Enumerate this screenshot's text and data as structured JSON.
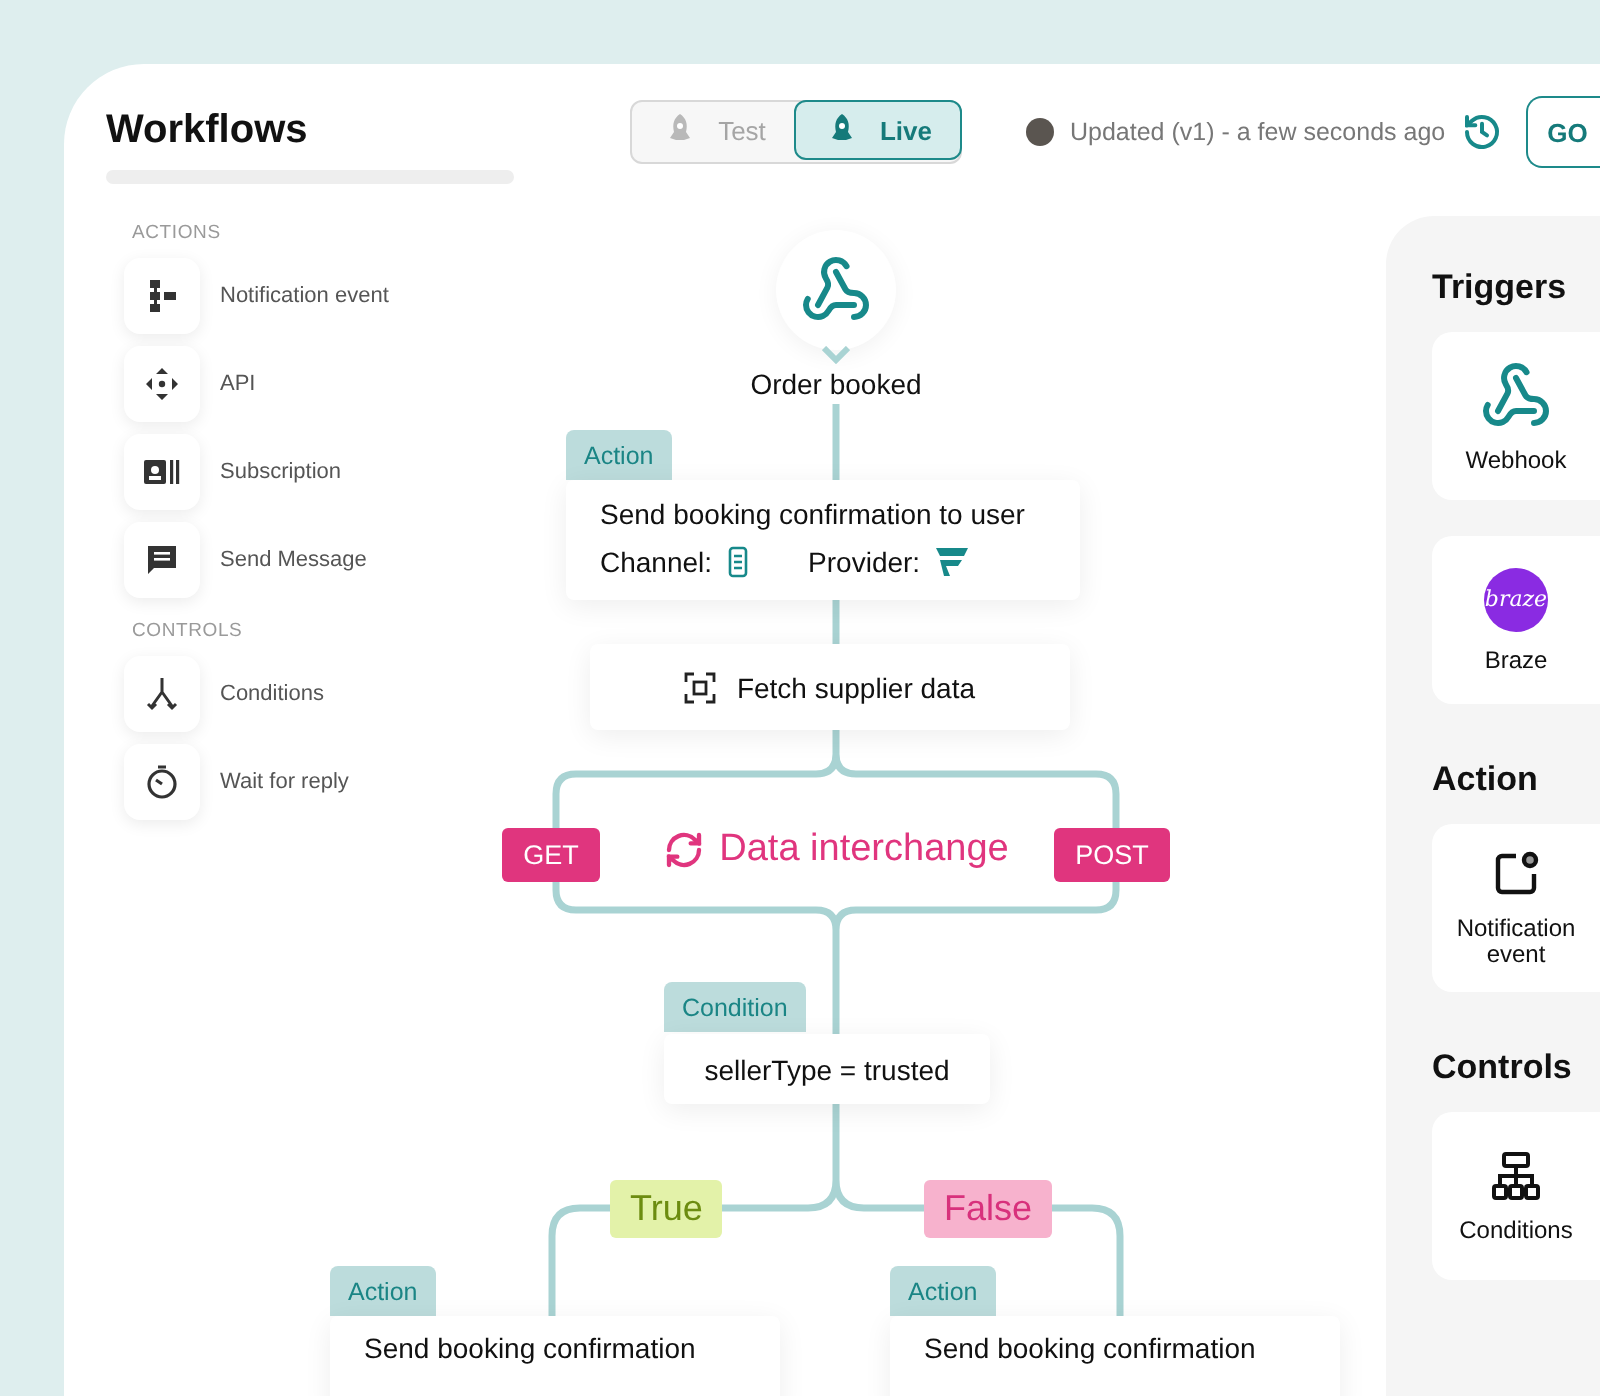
{
  "title": "Workflows",
  "mode_toggle": [
    {
      "label": "Test",
      "selected": false
    },
    {
      "label": "Live",
      "selected": true
    }
  ],
  "update_status": "Updated (v1) - a few seconds ago",
  "header_button": "GO",
  "sidebar": [
    {
      "heading": "ACTIONS",
      "items": [
        {
          "label": "Notification event"
        },
        {
          "label": "API"
        },
        {
          "label": "Subscription"
        },
        {
          "label": "Send Message"
        }
      ]
    },
    {
      "heading": "CONTROLS",
      "items": [
        {
          "label": "Conditions"
        },
        {
          "label": "Wait for reply"
        }
      ]
    }
  ],
  "flow": {
    "trigger": {
      "label": "Order booked"
    },
    "first_action": {
      "tag": "Action",
      "title": "Send booking confirmation to user",
      "channel_label": "Channel:",
      "provider_label": "Provider:"
    },
    "fetch": {
      "label": "Fetch supplier data"
    },
    "interchange": {
      "label": "Data interchange",
      "left_method": "GET",
      "right_method": "POST"
    },
    "condition": {
      "tag": "Condition",
      "expression": "sellerType = trusted"
    },
    "branches": [
      {
        "label": "True",
        "kind": "true",
        "color": "#e3f2a9",
        "action": {
          "tag": "Action",
          "title": "Send booking confirmation"
        }
      },
      {
        "label": "False",
        "kind": "false",
        "color": "#f7b2cd",
        "action": {
          "tag": "Action",
          "title": "Send booking confirmation"
        }
      }
    ]
  },
  "right_panel": [
    {
      "heading": "Triggers",
      "items": [
        {
          "label": "Webhook"
        },
        {
          "label": "Braze",
          "logo_text": "braze"
        }
      ]
    },
    {
      "heading": "Action",
      "items": [
        {
          "label": "Notification event"
        }
      ]
    },
    {
      "heading": "Controls",
      "items": [
        {
          "label": "Conditions"
        }
      ]
    }
  ]
}
